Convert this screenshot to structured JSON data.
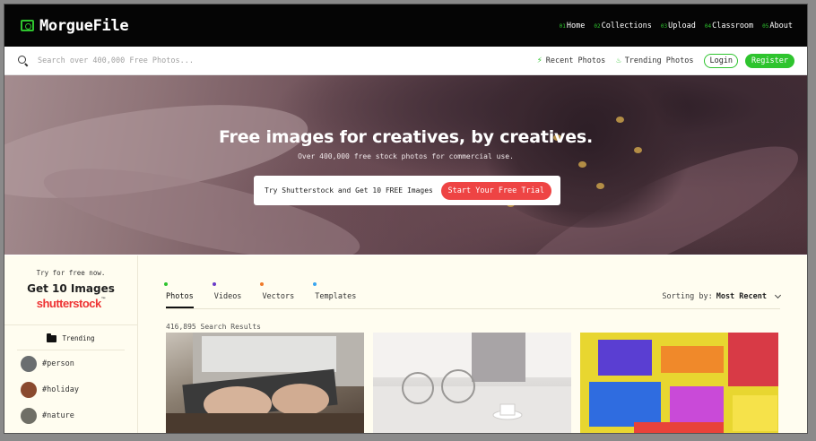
{
  "brand": {
    "name": "MorgueFile"
  },
  "nav": [
    {
      "num": "01",
      "label": "Home"
    },
    {
      "num": "02",
      "label": "Collections"
    },
    {
      "num": "03",
      "label": "Upload"
    },
    {
      "num": "04",
      "label": "Classroom"
    },
    {
      "num": "05",
      "label": "About"
    }
  ],
  "search": {
    "placeholder": "Search over 400,000 Free Photos...",
    "recent_label": "Recent Photos",
    "trending_label": "Trending Photos",
    "login_label": "Login",
    "register_label": "Register"
  },
  "hero": {
    "title": "Free images for creatives, by creatives.",
    "subtitle": "Over 400,000 free stock photos for commercial use.",
    "promo_text": "Try Shutterstock and Get 10 FREE Images",
    "promo_button": "Start Your Free Trial"
  },
  "sidebar": {
    "try_text": "Try for free now.",
    "get_text": "Get 10 Images",
    "brand": "shutterstock",
    "trending_label": "Trending",
    "tags": [
      {
        "label": "#person",
        "color": "#6a6e70"
      },
      {
        "label": "#holiday",
        "color": "#8a4a2e"
      },
      {
        "label": "#nature",
        "color": "#6f6f66"
      }
    ]
  },
  "main": {
    "tabs": [
      {
        "label": "Photos",
        "dot_color": "#2ec42e",
        "active": true
      },
      {
        "label": "Videos",
        "dot_color": "#6a3cc8",
        "active": false
      },
      {
        "label": "Vectors",
        "dot_color": "#f07a2a",
        "active": false
      },
      {
        "label": "Templates",
        "dot_color": "#3aa6f0",
        "active": false
      }
    ],
    "sorting_label": "Sorting by:",
    "sorting_value": "Most Recent",
    "results_text": "416,895 Search Results"
  },
  "colors": {
    "accent": "#2ec42e",
    "promo": "#ee4444"
  }
}
